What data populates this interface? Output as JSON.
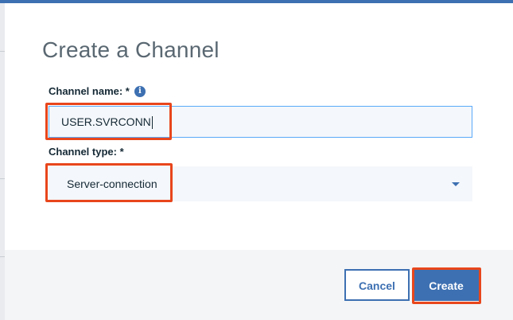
{
  "dialog": {
    "title": "Create a Channel"
  },
  "fields": {
    "channel_name": {
      "label": "Channel name: *",
      "value": "USER.SVRCONN",
      "info_icon": "info-icon"
    },
    "channel_type": {
      "label": "Channel type: *",
      "selected": "Server-connection",
      "icon": "chevron-down-icon"
    }
  },
  "footer": {
    "cancel_label": "Cancel",
    "create_label": "Create"
  },
  "colors": {
    "accent": "#3d70b2",
    "highlight": "#e8461c",
    "input_border": "#5aaafa",
    "footer_bg": "#f4f5f7"
  }
}
